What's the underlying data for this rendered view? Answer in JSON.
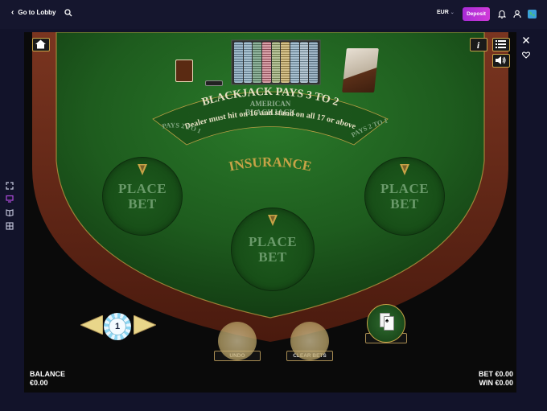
{
  "topbar": {
    "back_label": "Go to Lobby",
    "currency": "EUR",
    "deposit_label": "Deposit"
  },
  "table": {
    "logo_line1": "AMERICAN",
    "logo_line2": "BLACKJACK",
    "pays_left": "PAYS 2 TO 1",
    "pays_right": "PAYS 2 TO 1",
    "blackjack_pays": "BLACKJACK PAYS 3 TO 2",
    "dealer_rule": "Dealer must hit on 16 and stand on all 17 or above",
    "insurance": "INSURANCE",
    "spots": [
      {
        "line1": "PLACE",
        "line2": "BET"
      },
      {
        "line1": "PLACE",
        "line2": "BET"
      },
      {
        "line1": "PLACE",
        "line2": "BET"
      }
    ]
  },
  "controls": {
    "chip_value": "1",
    "undo_label": "UNDO",
    "clear_label": "CLEAR BETS",
    "deal_label": "DEAL"
  },
  "footer": {
    "balance_label": "BALANCE",
    "balance_value": "€0.00",
    "bet_label": "BET",
    "bet_value": "€0.00",
    "win_label": "WIN",
    "win_value": "€0.00"
  },
  "colors": {
    "felt": "#1e5c1e",
    "gold": "#c7a347",
    "rail": "#6e2a18",
    "deposit": "#c235d7"
  }
}
